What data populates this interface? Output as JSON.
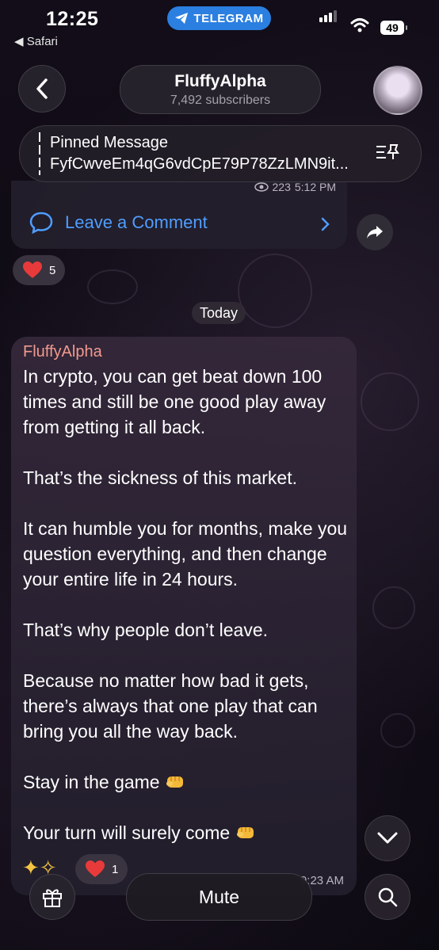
{
  "status_bar": {
    "time": "12:25",
    "back_app": "◀ Safari",
    "telegram_label": "TELEGRAM",
    "battery": "49"
  },
  "header": {
    "channel_name": "FluffyAlpha",
    "subscribers": "7,492 subscribers"
  },
  "pinned": {
    "label": "Pinned Message",
    "text": "FyfCwveEm4qG6vdCpE79P78ZzLMN9it..."
  },
  "previous_post": {
    "views": "223",
    "time": "5:12 PM",
    "comment_label": "Leave a Comment",
    "reaction_count": "5"
  },
  "date_separator": "Today",
  "message": {
    "sender": "FluffyAlpha",
    "paragraphs": [
      "In crypto, you can get beat down 100 times and still be one good play away from getting it all back.",
      "That’s the sickness of this market.",
      "It can humble you for months, make you question everything, and then change your entire life in 24 hours.",
      "That’s why people don’t leave.",
      "Because no matter how bad it gets, there’s always that one play that can bring you all the way back.",
      "Stay in the game",
      "Your turn will surely come"
    ],
    "time": "9:23 AM",
    "reaction_count": "1"
  },
  "bottom_bar": {
    "mute_label": "Mute"
  },
  "colors": {
    "accent": "#4f9dff",
    "sender": "#f29a8f",
    "telegram": "#2b7fe0"
  }
}
